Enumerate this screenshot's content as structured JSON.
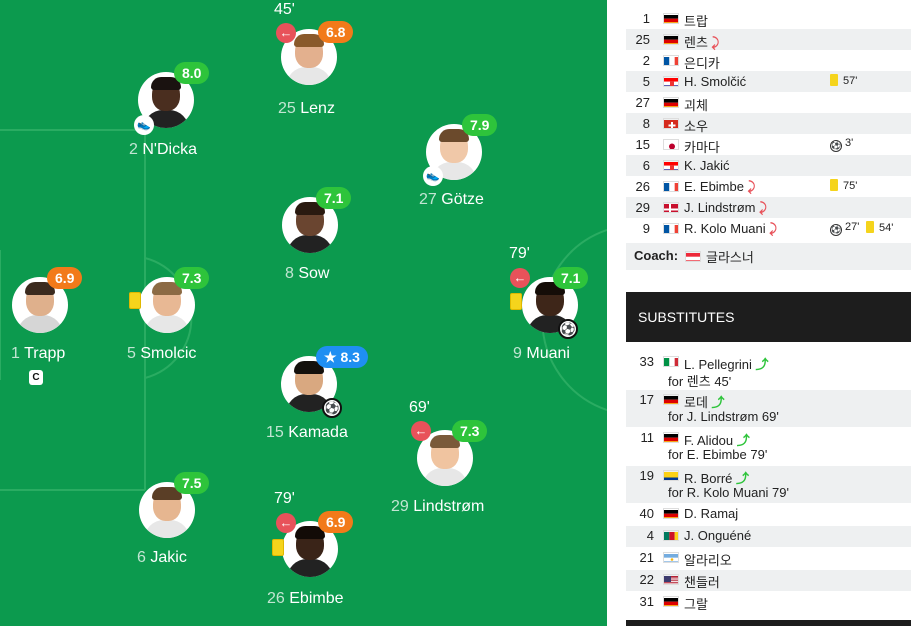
{
  "colors": {
    "pitch": "#0c9a4e",
    "rating_green": "#2ec43b",
    "rating_orange": "#f27a1a",
    "rating_blue": "#1f8ff2",
    "sub_out": "#e8525a"
  },
  "pitch": {
    "players": {
      "lenz": {
        "rating": "6.8",
        "minute": "45'",
        "number": "25",
        "name": "Lenz"
      },
      "ndicka": {
        "rating": "8.0",
        "number": "2",
        "name": "N'Dicka"
      },
      "gotze": {
        "rating": "7.9",
        "number": "27",
        "name": "Götze"
      },
      "sow": {
        "rating": "7.1",
        "number": "8",
        "name": "Sow"
      },
      "trapp": {
        "rating": "6.9",
        "number": "1",
        "name": "Trapp",
        "captain": "C"
      },
      "smolcic": {
        "rating": "7.3",
        "number": "5",
        "name": "Smolcic"
      },
      "muani": {
        "rating": "7.1",
        "minute": "79'",
        "number": "9",
        "name": "Muani"
      },
      "kamada": {
        "rating": "8.3",
        "star": "★",
        "number": "15",
        "name": "Kamada"
      },
      "lindstrom": {
        "rating": "7.3",
        "minute": "69'",
        "number": "29",
        "name": "Lindstrøm"
      },
      "jakic": {
        "rating": "7.5",
        "number": "6",
        "name": "Jakic"
      },
      "ebimbe": {
        "rating": "6.9",
        "minute": "79'",
        "number": "26",
        "name": "Ebimbe"
      }
    }
  },
  "lineup": [
    {
      "no": "1",
      "name": "트랍",
      "flag": "de"
    },
    {
      "no": "25",
      "name": "렌츠",
      "flag": "de",
      "subbed": true
    },
    {
      "no": "2",
      "name": "은디카",
      "flag": "fr"
    },
    {
      "no": "5",
      "name": "H. Smolčić",
      "flag": "hr",
      "card_minute": "57'"
    },
    {
      "no": "27",
      "name": "괴체",
      "flag": "de"
    },
    {
      "no": "8",
      "name": "소우",
      "flag": "ch"
    },
    {
      "no": "15",
      "name": "카마다",
      "flag": "jp",
      "goal_minute": "3'"
    },
    {
      "no": "6",
      "name": "K. Jakić",
      "flag": "hr"
    },
    {
      "no": "26",
      "name": "E. Ebimbe",
      "flag": "fr",
      "subbed": true,
      "card_minute": "75'"
    },
    {
      "no": "29",
      "name": "J. Lindstrøm",
      "flag": "dk",
      "subbed": true
    },
    {
      "no": "9",
      "name": "R. Kolo Muani",
      "flag": "fr",
      "subbed": true,
      "goal_minute": "27'",
      "card_minute": "54'"
    }
  ],
  "coach": {
    "label": "Coach:",
    "name": "글라스너",
    "flag": "at"
  },
  "substitutes_header": "SUBSTITUTES",
  "substitutes": [
    {
      "no": "33",
      "name": "L. Pellegrini",
      "flag": "it",
      "for": "for 렌츠 45'"
    },
    {
      "no": "17",
      "name": "로데",
      "flag": "de",
      "for": "for J. Lindstrøm 69'"
    },
    {
      "no": "11",
      "name": "F. Alidou",
      "flag": "de",
      "for": "for E. Ebimbe 79'"
    },
    {
      "no": "19",
      "name": "R. Borré",
      "flag": "co",
      "for": "for R. Kolo Muani 79'"
    },
    {
      "no": "40",
      "name": "D. Ramaj",
      "flag": "de"
    },
    {
      "no": "4",
      "name": "J. Onguéné",
      "flag": "cm"
    },
    {
      "no": "21",
      "name": "알라리오",
      "flag": "ar"
    },
    {
      "no": "22",
      "name": "챈들러",
      "flag": "us"
    },
    {
      "no": "31",
      "name": "그랄",
      "flag": "de"
    }
  ]
}
